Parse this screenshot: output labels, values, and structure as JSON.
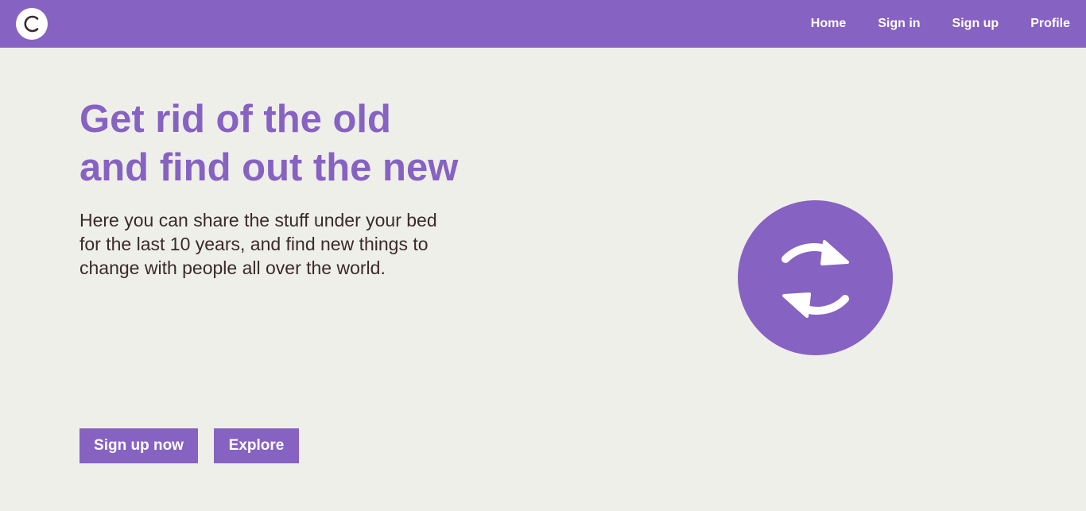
{
  "header": {
    "logo_letter": "C",
    "nav": [
      {
        "label": "Home"
      },
      {
        "label": "Sign in"
      },
      {
        "label": "Sign up"
      },
      {
        "label": "Profile"
      }
    ]
  },
  "hero": {
    "title_line1": "Get rid of the old",
    "title_line2": "and find out the new",
    "text_line1": "Here you can share the stuff under your bed",
    "text_line2": "for the last 10 years, and find new things to",
    "text_line3": "change with people all over the world.",
    "emblem_icon": "sync-arrows-icon"
  },
  "actions": {
    "signup_label": "Sign up now",
    "explore_label": "Explore"
  },
  "colors": {
    "brand": "#8662c2",
    "background": "#efefea",
    "text": "#3a2a2a"
  }
}
